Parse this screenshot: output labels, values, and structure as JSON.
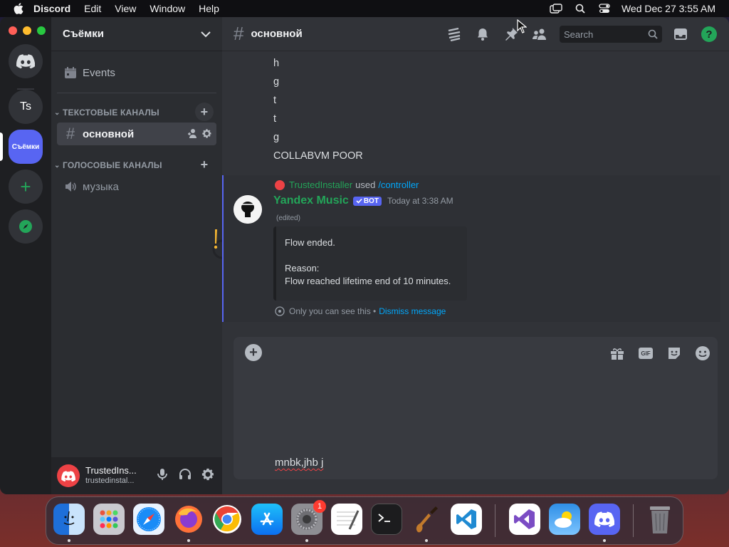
{
  "menubar": {
    "app_name": "Discord",
    "items": [
      "Edit",
      "View",
      "Window",
      "Help"
    ],
    "clock": "Wed Dec 27  3:55 AM"
  },
  "servers": {
    "items": [
      {
        "label": "Ts"
      },
      {
        "label": "Съёмки"
      }
    ]
  },
  "guild": {
    "name": "Съёмки",
    "events_label": "Events",
    "categories": [
      {
        "name": "ТЕКСТОВЫЕ КАНАЛЫ",
        "channels": [
          {
            "name": "основной"
          }
        ]
      },
      {
        "name": "ГОЛОСОВЫЕ КАНАЛЫ",
        "channels": [
          {
            "name": "музыка"
          }
        ]
      }
    ]
  },
  "user": {
    "display_name": "TrustedIns...",
    "tag": "trustedinstal..."
  },
  "channel": {
    "name": "основной",
    "search_placeholder": "Search"
  },
  "messages": {
    "lines": [
      "h",
      "g",
      "t",
      "t",
      "g",
      "COLLABVM POOR"
    ],
    "reply": {
      "user": "TrustedInstaller",
      "used": "used",
      "command": "/controller"
    },
    "author": "Yandex Music",
    "bot_tag": "BOT",
    "timestamp": "Today at 3:38 AM",
    "edited": "(edited)",
    "embed": {
      "line1": "Flow ended.",
      "line2": "Reason:",
      "line3": "Flow reached lifetime end of 10 minutes."
    },
    "ephemeral": "Only you can see this •",
    "dismiss": "Dismiss message"
  },
  "composer": {
    "text": "mnbk,jhb j",
    "gif_label": "GIF"
  },
  "dock": {
    "badge": "1"
  },
  "colors": {
    "blurple": "#5865f2",
    "green": "#23a559",
    "link": "#00a8fc",
    "red": "#ed4245"
  }
}
